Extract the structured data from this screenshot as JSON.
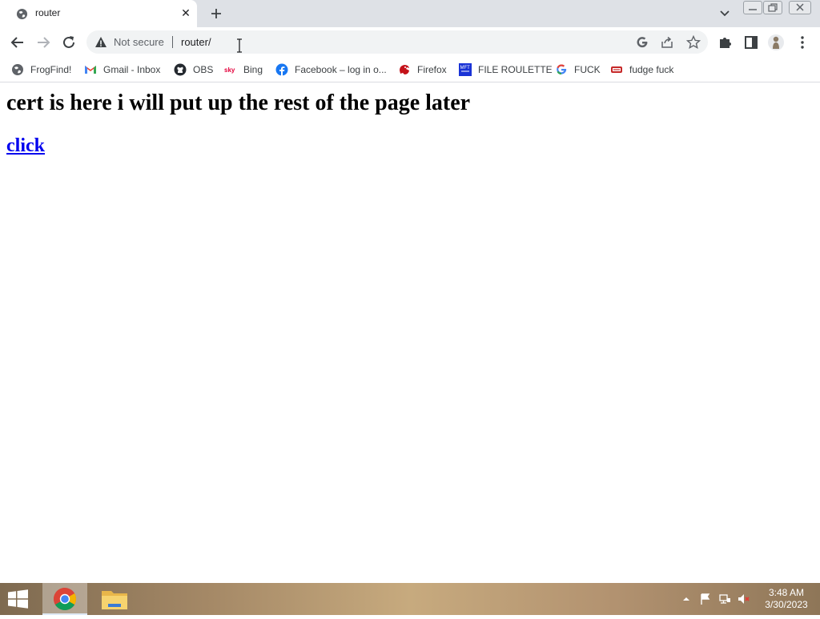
{
  "browser": {
    "tab": {
      "title": "router",
      "close_glyph": "✕"
    },
    "address_bar": {
      "security_label": "Not secure",
      "url": "router/"
    }
  },
  "bookmarks": [
    {
      "label": "FrogFind!",
      "icon": "globe-icon"
    },
    {
      "label": "Gmail - Inbox",
      "icon": "gmail-icon"
    },
    {
      "label": "OBS",
      "icon": "github-icon"
    },
    {
      "label": "Bing",
      "icon": "sky-icon"
    },
    {
      "label": "Facebook – log in o...",
      "icon": "facebook-icon"
    },
    {
      "label": "Firefox",
      "icon": "firefox-icon"
    },
    {
      "label": "FILE ROULETTE",
      "icon": "mft-icon"
    },
    {
      "label": "FUCK",
      "icon": "google-icon"
    },
    {
      "label": "fudge fuck",
      "icon": "red-badge-icon"
    }
  ],
  "page": {
    "heading": "cert is here i will put up the rest of the page later",
    "link": "click"
  },
  "taskbar": {
    "time": "3:48 AM",
    "date": "3/30/2023"
  },
  "colors": {
    "tabstrip": "#dee1e6",
    "omnibox": "#f1f3f4",
    "link": "#0000ee"
  }
}
